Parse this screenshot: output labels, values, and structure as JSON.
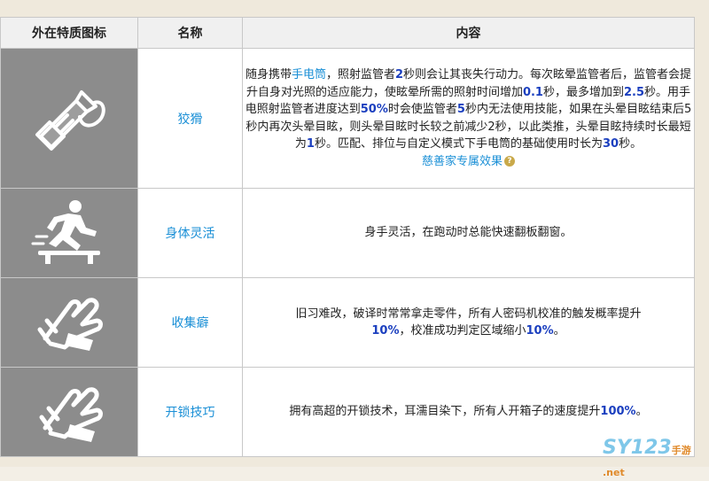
{
  "headers": {
    "icon": "外在特质图标",
    "name": "名称",
    "content": "内容"
  },
  "rows": [
    {
      "icon": "flashlight-icon",
      "name": "狡猾",
      "content": {
        "p1": "随身携带",
        "link1": "手电筒",
        "p2": "，照射监管者",
        "v1": "2",
        "p3": "秒则会让其丧失行动力。每次眩晕监管者后，监管者会提升自身对光照的适应能力，使眩晕所需的照射时间增加",
        "v2": "0.1",
        "p4": "秒，最多增加到",
        "v3": "2.5",
        "p5": "秒。用手电照射监管者进度达到",
        "v4": "50%",
        "p6": "时会使监管者",
        "v5": "5",
        "p7": "秒内无法使用技能，如果在头晕目眩结束后5秒内再次头晕目眩，则头晕目眩时长较之前减少2秒，以此类推，头晕目眩持续时长最短为",
        "v6": "1",
        "p8": "秒。匹配、排位与自定义模式下手电筒的基础使用时长为",
        "v7": "30",
        "p9": "秒。",
        "exclusive": "慈善家专属效果",
        "help": "?"
      }
    },
    {
      "icon": "vault-running-icon",
      "name": "身体灵活",
      "content": "身手灵活，在跑动时总能快速翻板翻窗。"
    },
    {
      "icon": "grabbing-hand-icon",
      "name": "收集癖",
      "content": {
        "p1": "旧习难改，破译时常常拿走零件，所有人密码机校准的触发概率提升",
        "v1": "10%",
        "p2": "，校准成功判定区域缩小",
        "v2": "10%",
        "p3": "。"
      }
    },
    {
      "icon": "lockpick-hand-icon",
      "name": "开锁技巧",
      "content": {
        "p1": "拥有高超的开锁技术，耳濡目染下，所有人开箱子的速度提升",
        "v1": "100%",
        "p2": "。"
      }
    }
  ],
  "watermark": {
    "text": "SY123",
    "sub": "手游 .net"
  }
}
